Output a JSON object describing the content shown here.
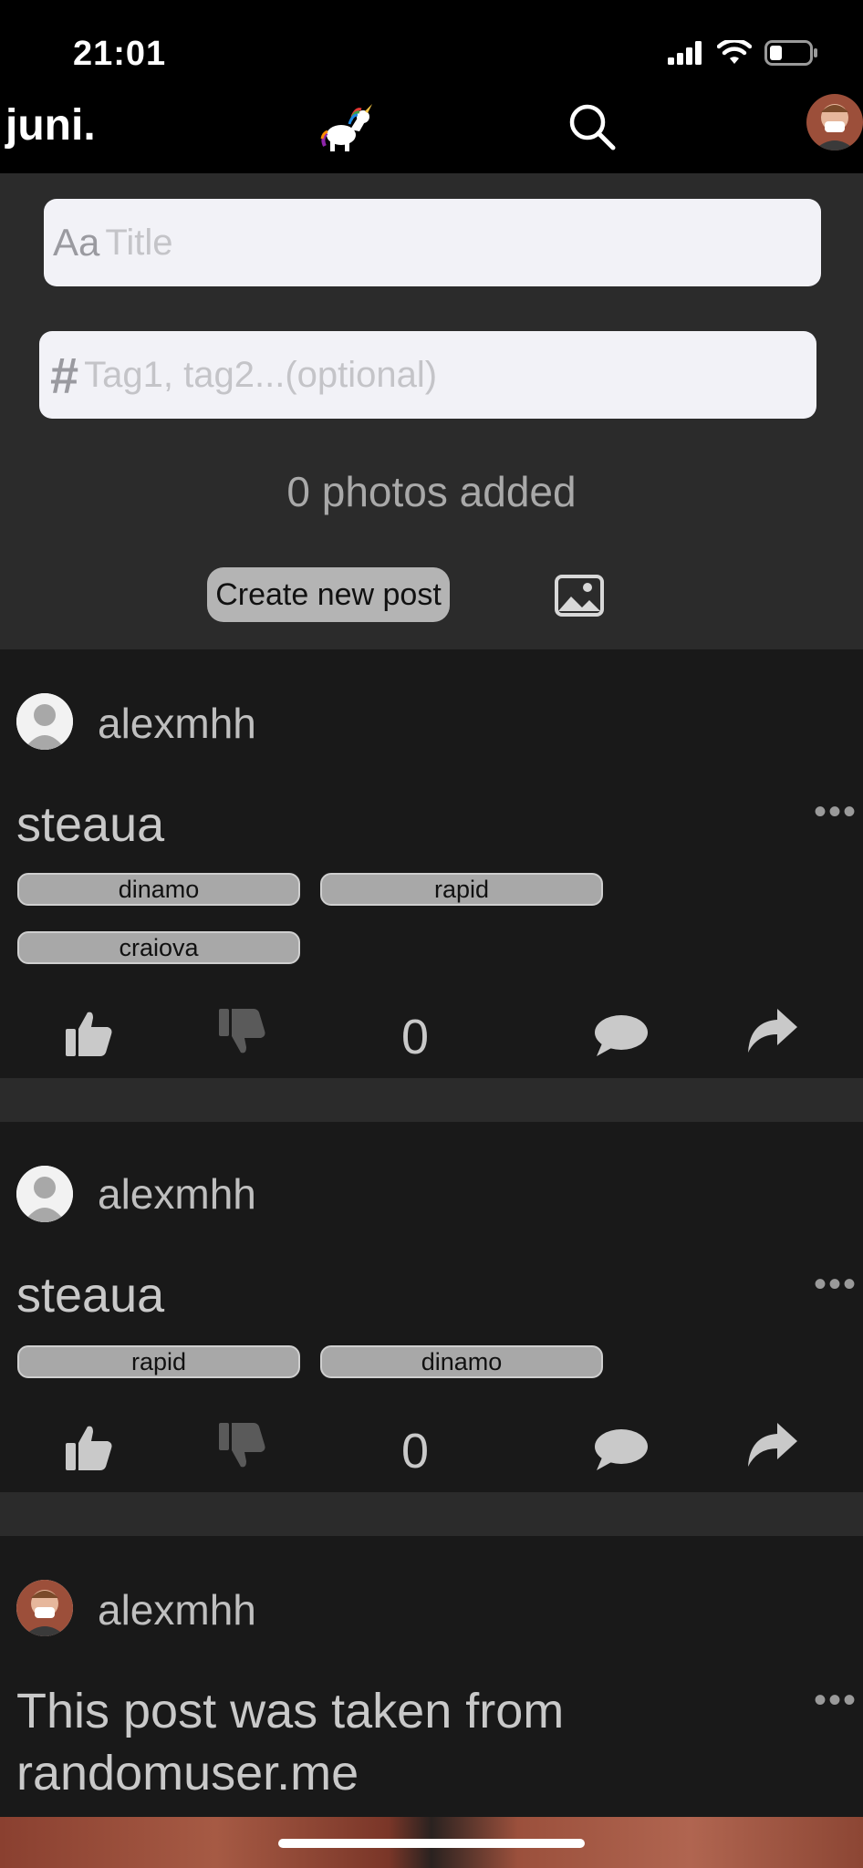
{
  "status_bar": {
    "time": "21:01"
  },
  "nav": {
    "logo": "juni."
  },
  "composer": {
    "title_prefix": "Aa",
    "title_placeholder": "Title",
    "tags_prefix": "#",
    "tags_placeholder": "Tag1, tag2...(optional)",
    "photos_count": "0 photos added",
    "create_button": "Create new post"
  },
  "posts": [
    {
      "author": "alexmhh",
      "title": "steaua",
      "tags": [
        "dinamo",
        "rapid",
        "craiova"
      ],
      "score": "0",
      "more": "•••"
    },
    {
      "author": "alexmhh",
      "title": "steaua",
      "tags": [
        "rapid",
        "dinamo"
      ],
      "score": "0",
      "more": "•••"
    },
    {
      "author": "alexmhh",
      "title_line1": "This post was taken from",
      "title_line2": "randomuser.me",
      "more": "•••"
    }
  ]
}
